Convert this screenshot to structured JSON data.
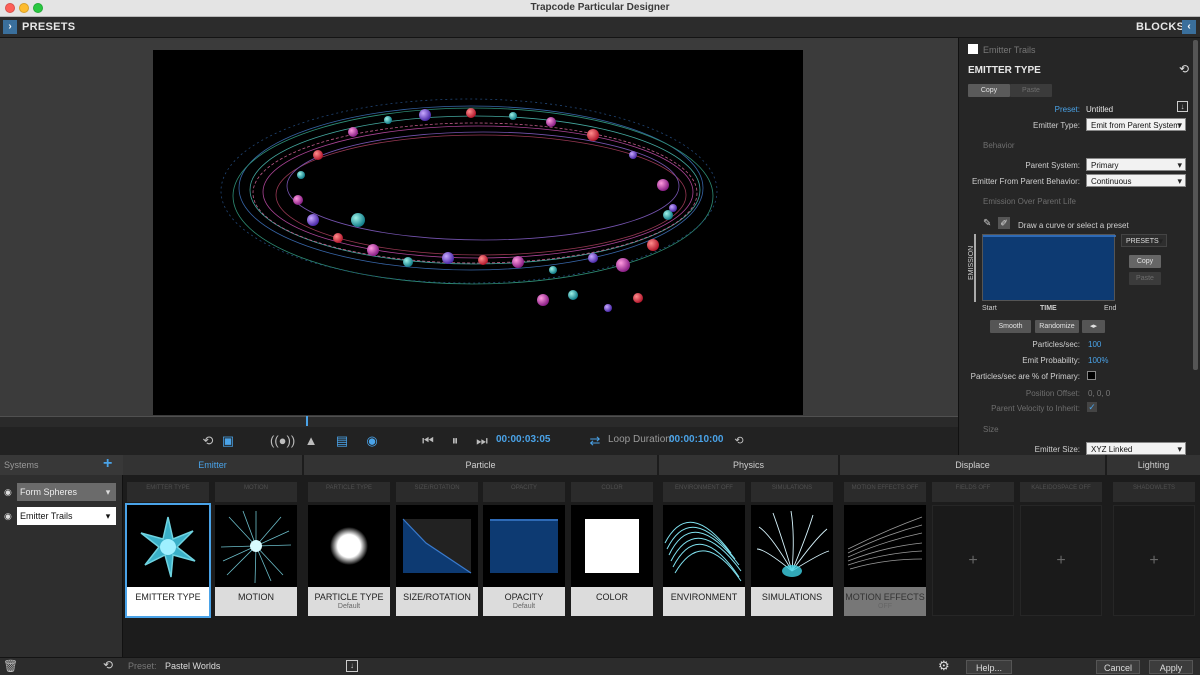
{
  "window": {
    "title": "Trapcode Particular Designer",
    "colors": {
      "close": "#fe5f57",
      "minimize": "#febc2e",
      "zoom": "#28c840",
      "accent": "#4aa3e8"
    }
  },
  "topbar": {
    "presets_label": "PRESETS",
    "blocks_label": "BLOCKS"
  },
  "transport": {
    "current_time": "00:00:03:05",
    "loop_label": "Loop Duration:",
    "loop_value": "00:00:10:00"
  },
  "panel": {
    "system_name": "Emitter Trails",
    "title": "EMITTER TYPE",
    "copy": "Copy",
    "paste": "Paste",
    "preset_label": "Preset:",
    "preset_value": "Untitled",
    "emitter_type_label": "Emitter Type:",
    "emitter_type_value": "Emit from Parent System",
    "behavior_heading": "Behavior",
    "parent_system_label": "Parent System:",
    "parent_system_value": "Primary",
    "emit_behavior_label": "Emitter From Parent Behavior:",
    "emit_behavior_value": "Continuous",
    "emission_heading": "Emission Over Parent Life",
    "curve_hint": "Draw a curve or select a preset",
    "curve_presets": "PRESETS",
    "curve_copy": "Copy",
    "curve_paste": "Paste",
    "emission_axis": "EMISSION",
    "time_start": "Start",
    "time_label": "TIME",
    "time_end": "End",
    "smooth": "Smooth",
    "randomize": "Randomize",
    "particles_sec_label": "Particles/sec:",
    "particles_sec_value": "100",
    "emit_prob_label": "Emit Probability:",
    "emit_prob_value": "100%",
    "pct_primary_label": "Particles/sec are % of Primary:",
    "position_offset_label": "Position Offset:",
    "position_offset_value": "0, 0, 0",
    "inherit_label": "Parent Velocity to Inherit:",
    "size_heading": "Size",
    "emitter_size_label": "Emitter Size:",
    "emitter_size_value": "XYZ Linked"
  },
  "systems": {
    "header": "Systems",
    "items": [
      {
        "name": "Form Spheres"
      },
      {
        "name": "Emitter Trails"
      }
    ]
  },
  "categories": [
    {
      "label": "Emitter"
    },
    {
      "label": "Particle"
    },
    {
      "label": "Physics"
    },
    {
      "label": "Displace"
    },
    {
      "label": "Lighting"
    }
  ],
  "subheaders": [
    "EMITTER TYPE",
    "MOTION",
    "PARTICLE TYPE",
    "SIZE/ROTATION",
    "OPACITY",
    "COLOR",
    "ENVIRONMENT OFF",
    "SIMULATIONS",
    "MOTION EFFECTS OFF",
    "FIELDS OFF",
    "KALEIDOSPACE OFF",
    "SHADOWLETS"
  ],
  "cards": [
    {
      "label": "EMITTER TYPE",
      "sub": ""
    },
    {
      "label": "MOTION",
      "sub": ""
    },
    {
      "label": "PARTICLE TYPE",
      "sub": "Default"
    },
    {
      "label": "SIZE/ROTATION",
      "sub": ""
    },
    {
      "label": "OPACITY",
      "sub": "Default"
    },
    {
      "label": "COLOR",
      "sub": ""
    },
    {
      "label": "ENVIRONMENT",
      "sub": ""
    },
    {
      "label": "SIMULATIONS",
      "sub": ""
    },
    {
      "label": "MOTION EFFECTS",
      "sub": "OFF"
    }
  ],
  "bottombar": {
    "preset_label": "Preset:",
    "preset_value": "Pastel Worlds",
    "help": "Help...",
    "cancel": "Cancel",
    "apply": "Apply"
  }
}
